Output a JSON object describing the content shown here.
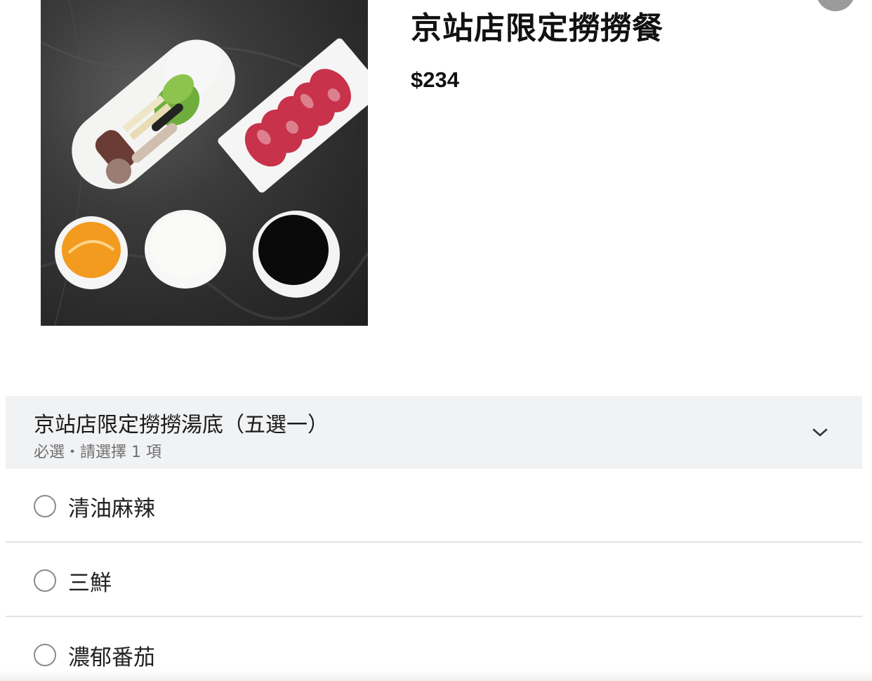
{
  "item": {
    "title": "京站店限定撈撈餐",
    "price": "$234",
    "image_icon": "hotpot-set-photo"
  },
  "option_group": {
    "title": "京站店限定撈撈湯底（五選一）",
    "subtitle": "必選・請選擇 1 項",
    "expanded_icon": "chevron-down-icon",
    "choices": [
      {
        "label": "清油麻辣",
        "selected": false
      },
      {
        "label": "三鮮",
        "selected": false
      },
      {
        "label": "濃郁番茄",
        "selected": false
      }
    ]
  },
  "colors": {
    "header_bg": "#f1f2f4",
    "divider": "#e3e3e3",
    "radio_border": "#8a8a8a",
    "close_button": "#9b9b9b"
  }
}
